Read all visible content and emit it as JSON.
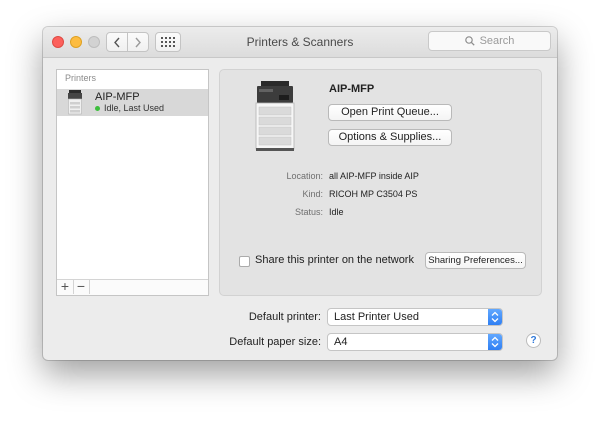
{
  "window": {
    "title": "Printers & Scanners",
    "search_placeholder": "Search"
  },
  "printer_list": {
    "header": "Printers",
    "items": [
      {
        "name": "AIP-MFP",
        "status": "Idle, Last Used",
        "status_color": "#3cbe3c"
      }
    ],
    "add_label": "+",
    "remove_label": "−"
  },
  "details": {
    "name": "AIP-MFP",
    "open_queue_label": "Open Print Queue...",
    "options_label": "Options & Supplies...",
    "location_label": "Location:",
    "location_value": "all AIP-MFP inside AIP",
    "kind_label": "Kind:",
    "kind_value": "RICOH MP C3504 PS",
    "status_label": "Status:",
    "status_value": "Idle",
    "share_label": "Share this printer on the network",
    "share_checked": false,
    "sharing_prefs_label": "Sharing Preferences..."
  },
  "defaults": {
    "printer_label": "Default printer:",
    "printer_value": "Last Printer Used",
    "paper_label": "Default paper size:",
    "paper_value": "A4"
  },
  "help_label": "?",
  "colors": {
    "close": "#fc605c",
    "minimize": "#fdbc40",
    "zoom_disabled": "#d2d2d2",
    "select_accent": "#2f7ff3"
  }
}
